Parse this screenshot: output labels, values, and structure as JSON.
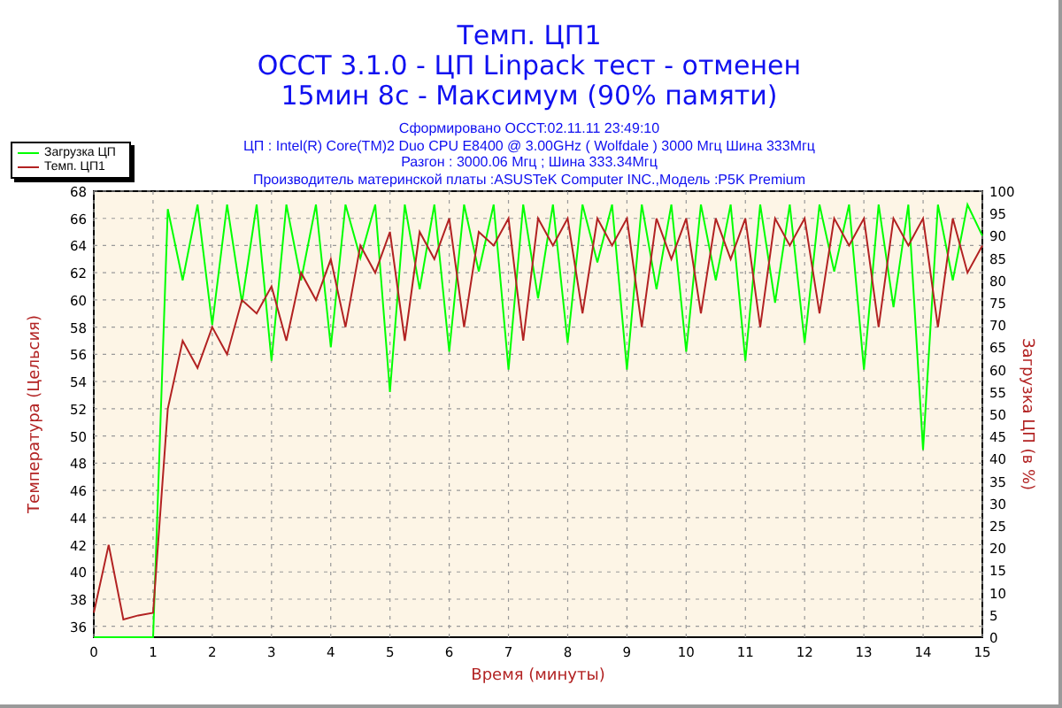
{
  "title_lines": [
    "Темп. ЦП1",
    "OCCT 3.1.0 - ЦП Linpack тест - отменен",
    "15мин 8с - Максимум (90% памяти)"
  ],
  "info_lines": [
    "Сформировано OCCT:02.11.11 23:49:10",
    "ЦП : Intel(R) Core(TM)2 Duo CPU E8400 @ 3.00GHz ( Wolfdale ) 3000 Мгц Шина 333Мгц",
    "Разгон : 3000.06 Мгц ; Шина 333.34Мгц",
    "Производитель материнской платы :ASUSTeK Computer INC.,Модель :P5K Premium"
  ],
  "chart_data": {
    "type": "line",
    "xlabel": "Время (минуты)",
    "ylabel": "Температура (Цельсия)",
    "y2label": "Загрузка ЦП (в %)",
    "grid": true,
    "xlim": [
      0,
      15
    ],
    "ylim": [
      35.2,
      68
    ],
    "y2lim": [
      0,
      100
    ],
    "xticks": [
      0,
      1,
      2,
      3,
      4,
      5,
      6,
      7,
      8,
      9,
      10,
      11,
      12,
      13,
      14,
      15
    ],
    "yticks": [
      36,
      38,
      40,
      42,
      44,
      46,
      48,
      50,
      52,
      54,
      56,
      58,
      60,
      62,
      64,
      66,
      68
    ],
    "y2ticks": [
      0,
      5,
      10,
      15,
      20,
      25,
      30,
      35,
      40,
      45,
      50,
      55,
      60,
      65,
      70,
      75,
      80,
      85,
      90,
      95,
      100
    ],
    "x": [
      0,
      0.25,
      0.5,
      0.75,
      1,
      1.25,
      1.5,
      1.75,
      2,
      2.25,
      2.5,
      2.75,
      3,
      3.25,
      3.5,
      3.75,
      4,
      4.25,
      4.5,
      4.75,
      5,
      5.25,
      5.5,
      5.75,
      6,
      6.25,
      6.5,
      6.75,
      7,
      7.25,
      7.5,
      7.75,
      8,
      8.25,
      8.5,
      8.75,
      9,
      9.25,
      9.5,
      9.75,
      10,
      10.25,
      10.5,
      10.75,
      11,
      11.25,
      11.5,
      11.75,
      12,
      12.25,
      12.5,
      12.75,
      13,
      13.25,
      13.5,
      13.75,
      14,
      14.25,
      14.5,
      14.75,
      15
    ],
    "series": [
      {
        "name": "Загрузка ЦП",
        "color": "#00ff00",
        "axis": "y2",
        "values": [
          0,
          0,
          0,
          0,
          0,
          96,
          80,
          97,
          70,
          97,
          75,
          97,
          62,
          97,
          80,
          97,
          65,
          97,
          85,
          97,
          55,
          97,
          78,
          97,
          64,
          97,
          82,
          97,
          60,
          97,
          76,
          97,
          66,
          97,
          84,
          97,
          60,
          97,
          78,
          97,
          64,
          97,
          80,
          97,
          62,
          97,
          75,
          97,
          66,
          97,
          82,
          97,
          60,
          97,
          74,
          97,
          42,
          97,
          80,
          97,
          90
        ]
      },
      {
        "name": "Темп. ЦП1",
        "color": "#b22222",
        "values": [
          37,
          42,
          36.5,
          36.8,
          37,
          52,
          57,
          55,
          58,
          56,
          60,
          59,
          61,
          57,
          62,
          60,
          63,
          58,
          64,
          62,
          65,
          57,
          65,
          63,
          66,
          58,
          65,
          64,
          66,
          57,
          66,
          64,
          66,
          59,
          66,
          64,
          66,
          58,
          66,
          63,
          66,
          59,
          66,
          63,
          66,
          58,
          66,
          64,
          66,
          59,
          66,
          64,
          66,
          58,
          66,
          64,
          66,
          58,
          66,
          62,
          64
        ]
      }
    ]
  }
}
